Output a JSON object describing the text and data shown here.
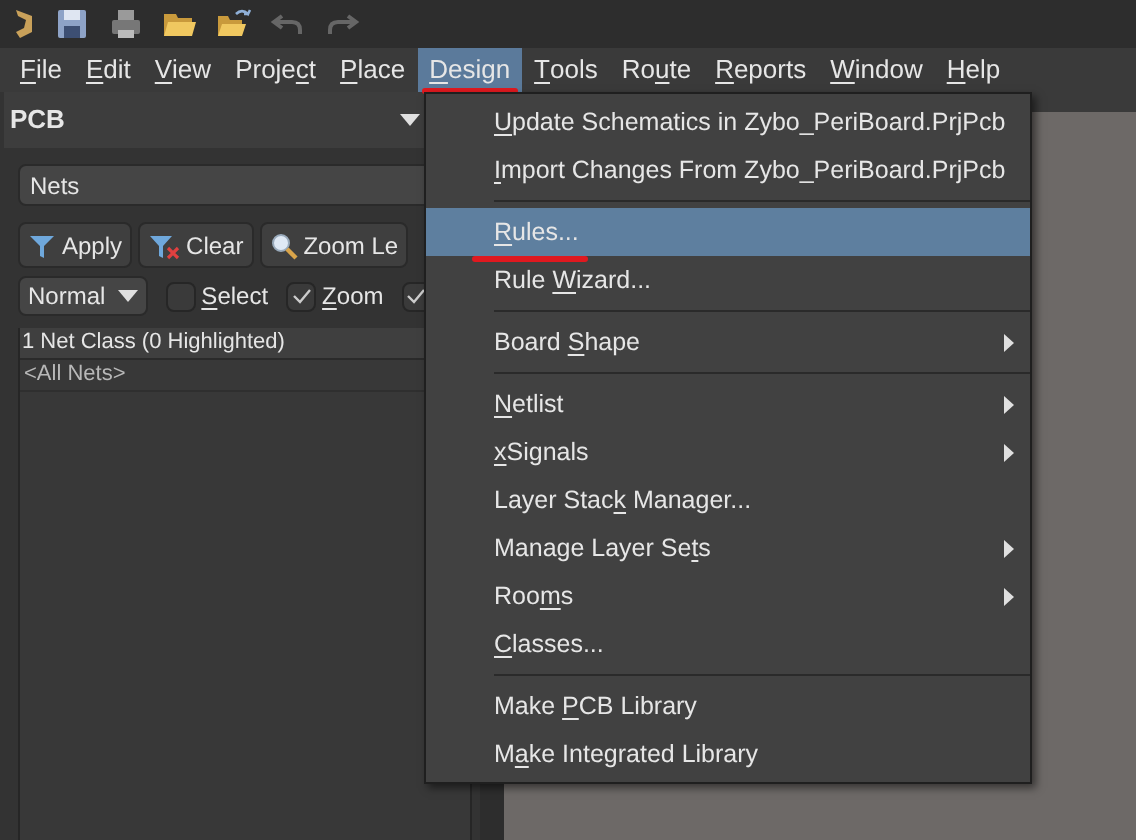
{
  "menubar": [
    {
      "key": "F",
      "post": "ile",
      "selected": false,
      "annotated": false
    },
    {
      "key": "E",
      "post": "dit",
      "selected": false,
      "annotated": false
    },
    {
      "key": "V",
      "post": "iew",
      "selected": false,
      "annotated": false
    },
    {
      "pre": "Proje",
      "key": "c",
      "post": "t",
      "selected": false,
      "annotated": false
    },
    {
      "key": "P",
      "post": "lace",
      "selected": false,
      "annotated": false
    },
    {
      "key": "D",
      "post": "esign",
      "selected": true,
      "annotated": true
    },
    {
      "key": "T",
      "post": "ools",
      "selected": false,
      "annotated": false
    },
    {
      "pre": "Ro",
      "key": "u",
      "post": "te",
      "selected": false,
      "annotated": false
    },
    {
      "key": "R",
      "post": "eports",
      "selected": false,
      "annotated": false
    },
    {
      "key": "W",
      "post": "indow",
      "selected": false,
      "annotated": false
    },
    {
      "key": "H",
      "post": "elp",
      "selected": false,
      "annotated": false
    }
  ],
  "panel": {
    "title": "PCB",
    "mode": "Nets",
    "buttons": [
      {
        "kind": "apply",
        "label": "Apply"
      },
      {
        "kind": "clear",
        "label": "Clear"
      },
      {
        "kind": "zoom",
        "label": "Zoom Le"
      }
    ],
    "view_mode": "Normal",
    "checkboxes": [
      {
        "key": "S",
        "post": "elect",
        "checked": false
      },
      {
        "key": "Z",
        "post": "oom",
        "checked": true
      },
      {
        "checked": true
      }
    ],
    "list_header": "1 Net Class (0 Highlighted)",
    "rows": [
      "<All Nets>"
    ]
  },
  "design_menu": [
    {
      "kind": "item",
      "key": "U",
      "post": "pdate Schematics in Zybo_PeriBoard.PrjPcb",
      "selected": false,
      "submenu": false,
      "annotated": false
    },
    {
      "kind": "item",
      "key": "I",
      "post": "mport Changes From Zybo_PeriBoard.PrjPcb",
      "selected": false,
      "submenu": false,
      "annotated": false
    },
    {
      "kind": "separator"
    },
    {
      "kind": "item",
      "key": "R",
      "post": "ules...",
      "selected": true,
      "submenu": false,
      "annotated": true
    },
    {
      "kind": "item",
      "pre": "Rule ",
      "key": "W",
      "post": "izard...",
      "selected": false,
      "submenu": false,
      "annotated": false
    },
    {
      "kind": "separator"
    },
    {
      "kind": "item",
      "pre": "Board ",
      "key": "S",
      "post": "hape",
      "selected": false,
      "submenu": true,
      "annotated": false
    },
    {
      "kind": "separator"
    },
    {
      "kind": "item",
      "key": "N",
      "post": "etlist",
      "selected": false,
      "submenu": true,
      "annotated": false
    },
    {
      "kind": "item",
      "key": "x",
      "post": "Signals",
      "selected": false,
      "submenu": true,
      "annotated": false
    },
    {
      "kind": "item",
      "pre": "Layer Stac",
      "key": "k",
      "post": " Manager...",
      "selected": false,
      "submenu": false,
      "annotated": false
    },
    {
      "kind": "item",
      "pre": "Manage Layer Se",
      "key": "t",
      "post": "s",
      "selected": false,
      "submenu": true,
      "annotated": false
    },
    {
      "kind": "item",
      "pre": "Roo",
      "key": "m",
      "post": "s",
      "selected": false,
      "submenu": true,
      "annotated": false
    },
    {
      "kind": "item",
      "key": "C",
      "post": "lasses...",
      "selected": false,
      "submenu": false,
      "annotated": false
    },
    {
      "kind": "separator"
    },
    {
      "kind": "item",
      "pre": "Make ",
      "key": "P",
      "post": "CB Library",
      "selected": false,
      "submenu": false,
      "annotated": false
    },
    {
      "kind": "item",
      "pre": "M",
      "key": "a",
      "post": "ke Integrated Library",
      "selected": false,
      "submenu": false,
      "annotated": false
    }
  ]
}
